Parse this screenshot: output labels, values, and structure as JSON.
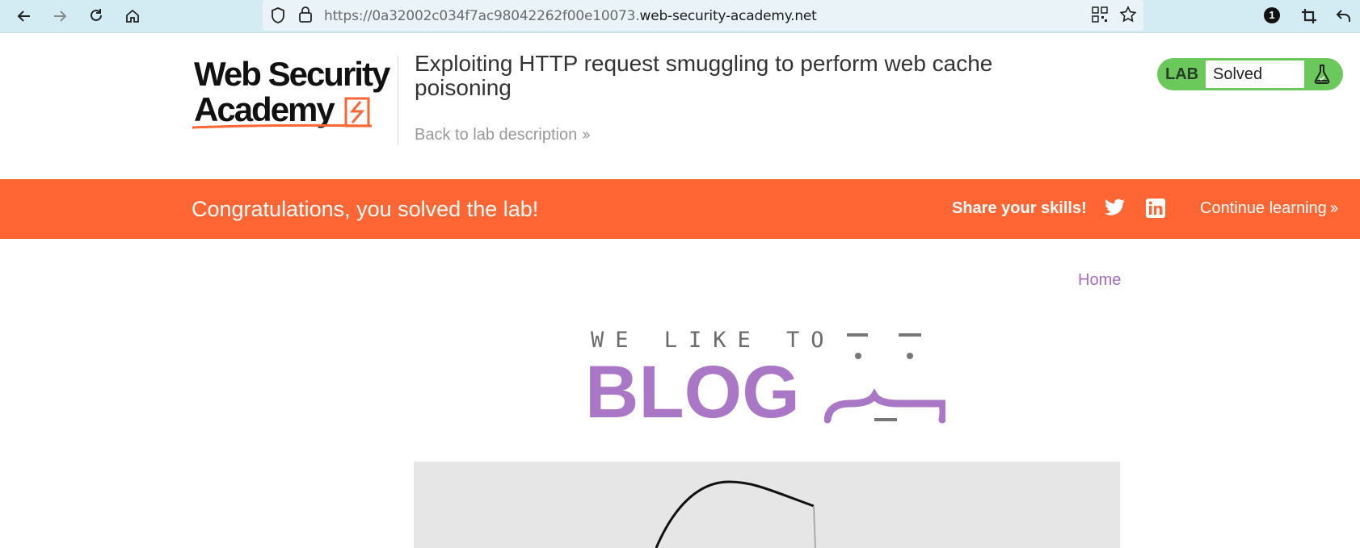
{
  "browser": {
    "url_prefix": "https://0a32002c034f7ac98042262f00e10073.",
    "url_host": "web-security-academy.net",
    "notification_count": "1"
  },
  "header": {
    "logo_text": "Web Security Academy",
    "lab_title": "Exploiting HTTP request smuggling to perform web cache poisoning",
    "back_link": "Back to lab description",
    "status_label": "LAB",
    "status_value": "Solved"
  },
  "banner": {
    "congrats": "Congratulations, you solved the lab!",
    "share": "Share your skills!",
    "continue": "Continue learning"
  },
  "blog": {
    "nav_home": "Home",
    "tagline": "WE LIKE TO",
    "word": "BLOG"
  },
  "colors": {
    "banner": "#ff6633",
    "solved": "#6ac95a",
    "accent": "#aa77c7"
  },
  "icons": [
    "back-arrow-icon",
    "forward-arrow-icon",
    "reload-icon",
    "home-icon",
    "shield-icon",
    "lock-icon",
    "qr-code-icon",
    "star-icon",
    "badge-icon",
    "crop-icon",
    "undo-icon",
    "flask-icon",
    "twitter-icon",
    "linkedin-icon"
  ]
}
